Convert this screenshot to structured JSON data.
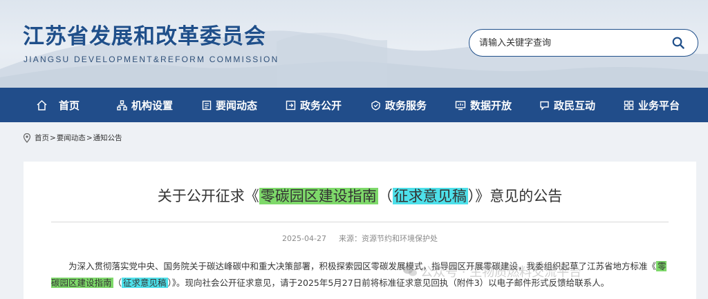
{
  "header": {
    "title": "江苏省发展和改革委员会",
    "subtitle": "JIANGSU DEVELOPMENT&REFORM COMMISSION"
  },
  "search": {
    "placeholder": "请输入关键字查询",
    "icon": "search-icon"
  },
  "nav": {
    "items": [
      {
        "label": "首页",
        "icon": "home-icon"
      },
      {
        "label": "机构设置",
        "icon": "org-chart-icon"
      },
      {
        "label": "要闻动态",
        "icon": "news-icon"
      },
      {
        "label": "政务公开",
        "icon": "open-govt-icon"
      },
      {
        "label": "政务服务",
        "icon": "service-icon"
      },
      {
        "label": "数据开放",
        "icon": "data-icon"
      },
      {
        "label": "政民互动",
        "icon": "chat-icon"
      },
      {
        "label": "业务平台",
        "icon": "grid-icon"
      }
    ]
  },
  "breadcrumb": {
    "items": [
      "首页",
      "要闻动态",
      "通知公告"
    ],
    "separator": ">"
  },
  "article": {
    "title_prefix": "关于公开征求《",
    "title_highlight1": "零碳园区建设指南",
    "title_mid": "（",
    "title_highlight2": "征求意见稿",
    "title_suffix": "）》意见的公告",
    "date": "2025-04-27",
    "source": "来源：资源节约和环境保护处",
    "body_line1": "为深入贯彻落实党中央、国务院关于碳达峰碳中和重大决策部署，积极探索园区零碳发展模式，指导园区开展零碳建设，我委组织起草了江苏省地方标",
    "body_line2_prefix": "准《",
    "body_line2_hl1": "零碳园区建设指南",
    "body_line2_mid": "（",
    "body_line2_hl2": "征求意见稿",
    "body_line2_suffix": "）》。现向社会公开征求意见，请于2025年5月27日前将标准征求意见回执（附件3）以电子邮件形式反馈给联系人。"
  },
  "watermark": "公众号 · 生物质燃料交流平台",
  "colors": {
    "nav_bg": "#214d8a",
    "title_blue": "#1f4f8a",
    "highlight_green": "#7ed96a",
    "highlight_cyan": "#4de0ea"
  }
}
